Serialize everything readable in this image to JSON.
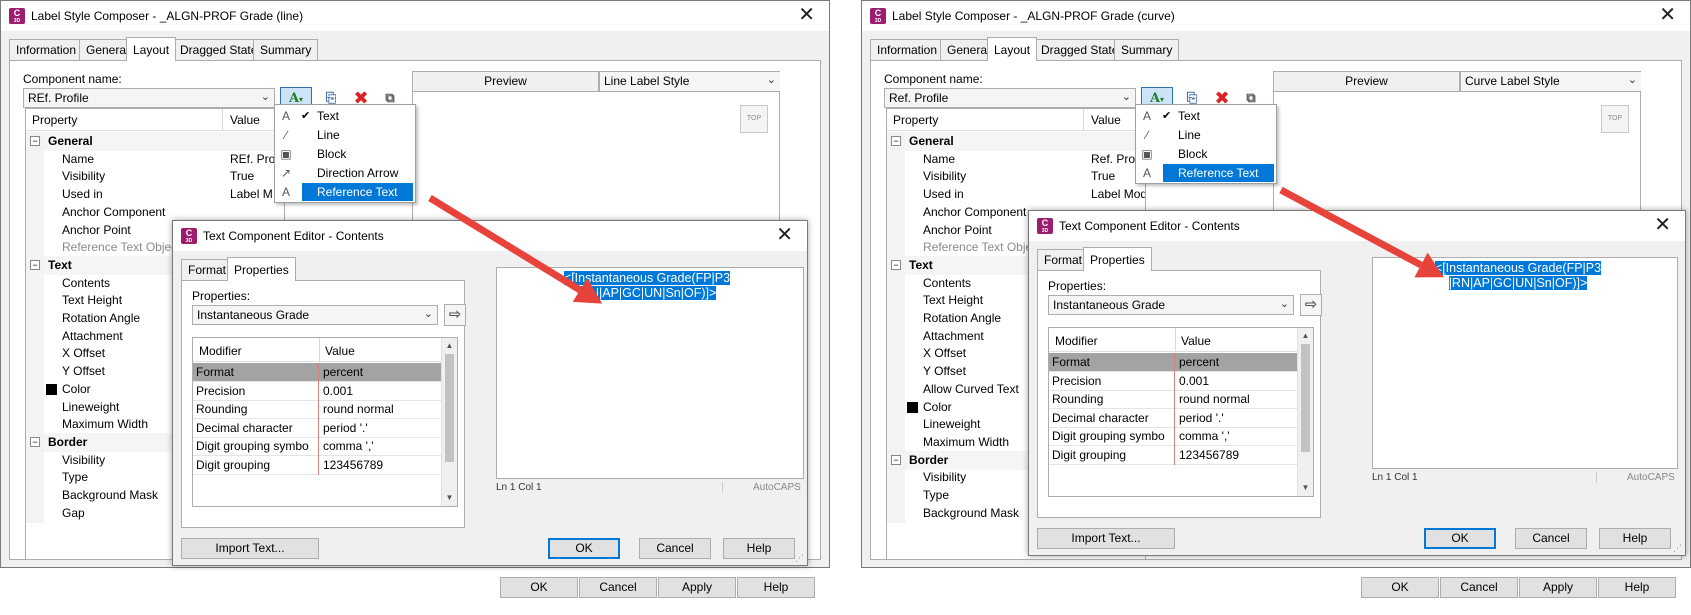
{
  "left": {
    "window_title": "Label Style Composer - _ALGN-PROF Grade (line)",
    "tabs": [
      "Information",
      "General",
      "Layout",
      "Dragged State",
      "Summary"
    ],
    "active_tab": "Layout",
    "component_name_label": "Component name:",
    "component_name_value": "REf. Profile",
    "preview_header": "Preview",
    "preview_style": "Line Label Style",
    "top_button": "TOP",
    "grid_headers": {
      "property": "Property",
      "value": "Value"
    },
    "properties": [
      {
        "name": "General",
        "category": true
      },
      {
        "name": "Name",
        "value": "REf. Pro"
      },
      {
        "name": "Visibility",
        "value": "True"
      },
      {
        "name": "Used in",
        "value": "Label M"
      },
      {
        "name": "Anchor Component",
        "value": ""
      },
      {
        "name": "Anchor Point",
        "value": ""
      },
      {
        "name": "Reference Text Object",
        "value": "",
        "dim": true
      },
      {
        "name": "Text",
        "category": true
      },
      {
        "name": "Contents",
        "value": ""
      },
      {
        "name": "Text Height",
        "value": ""
      },
      {
        "name": "Rotation Angle",
        "value": ""
      },
      {
        "name": "Attachment",
        "value": ""
      },
      {
        "name": "X Offset",
        "value": ""
      },
      {
        "name": "Y Offset",
        "value": ""
      },
      {
        "name": "Color",
        "value": "",
        "swatch": true
      },
      {
        "name": "Lineweight",
        "value": ""
      },
      {
        "name": "Maximum Width",
        "value": ""
      },
      {
        "name": "Border",
        "category": true
      },
      {
        "name": "Visibility",
        "value": ""
      },
      {
        "name": "Type",
        "value": ""
      },
      {
        "name": "Background Mask",
        "value": ""
      },
      {
        "name": "Gap",
        "value": ""
      }
    ],
    "menu": [
      {
        "label": "Text",
        "checked": true
      },
      {
        "label": "Line"
      },
      {
        "label": "Block"
      },
      {
        "label": "Direction Arrow"
      },
      {
        "label": "Reference Text",
        "highlighted": true
      }
    ],
    "editor": {
      "title": "Text Component Editor - Contents",
      "tabs": [
        "Format",
        "Properties"
      ],
      "active_tab": "Properties",
      "properties_label": "Properties:",
      "property_selected": "Instantaneous Grade",
      "grid_headers": {
        "modifier": "Modifier",
        "value": "Value"
      },
      "modifiers": [
        {
          "name": "Format",
          "value": "percent",
          "selected": true
        },
        {
          "name": "Precision",
          "value": "0.001"
        },
        {
          "name": "Rounding",
          "value": "round normal"
        },
        {
          "name": "Decimal character",
          "value": "period '.'"
        },
        {
          "name": "Digit grouping symbo",
          "value": "comma ','"
        },
        {
          "name": "Digit grouping",
          "value": "123456789"
        }
      ],
      "content_line1": "<[Instantaneous Grade(FP|P3",
      "content_line2": "|RN|AP|GC|UN|Sn|OF)]>",
      "status_pos": "Ln 1 Col 1",
      "status_caps": "AutoCAPS",
      "import_button": "Import Text...",
      "ok": "OK",
      "cancel": "Cancel",
      "help": "Help"
    },
    "buttons": {
      "ok": "OK",
      "cancel": "Cancel",
      "apply": "Apply",
      "help": "Help"
    }
  },
  "right": {
    "window_title": "Label Style Composer - _ALGN-PROF Grade (curve)",
    "tabs": [
      "Information",
      "General",
      "Layout",
      "Dragged State",
      "Summary"
    ],
    "active_tab": "Layout",
    "component_name_label": "Component name:",
    "component_name_value": "Ref. Profile",
    "preview_header": "Preview",
    "preview_style": "Curve Label Style",
    "top_button": "TOP",
    "grid_headers": {
      "property": "Property",
      "value": "Value"
    },
    "properties": [
      {
        "name": "General",
        "category": true
      },
      {
        "name": "Name",
        "value": "Ref. Pro"
      },
      {
        "name": "Visibility",
        "value": "True"
      },
      {
        "name": "Used in",
        "value": "Label Mode"
      },
      {
        "name": "Anchor Component",
        "value": ""
      },
      {
        "name": "Anchor Point",
        "value": ""
      },
      {
        "name": "Reference Text Object",
        "value": "",
        "dim": true
      },
      {
        "name": "Text",
        "category": true
      },
      {
        "name": "Contents",
        "value": ""
      },
      {
        "name": "Text Height",
        "value": ""
      },
      {
        "name": "Rotation Angle",
        "value": ""
      },
      {
        "name": "Attachment",
        "value": ""
      },
      {
        "name": "X Offset",
        "value": ""
      },
      {
        "name": "Y Offset",
        "value": ""
      },
      {
        "name": "Allow Curved Text",
        "value": ""
      },
      {
        "name": "Color",
        "value": "",
        "swatch": true
      },
      {
        "name": "Lineweight",
        "value": ""
      },
      {
        "name": "Maximum Width",
        "value": ""
      },
      {
        "name": "Border",
        "category": true
      },
      {
        "name": "Visibility",
        "value": ""
      },
      {
        "name": "Type",
        "value": ""
      },
      {
        "name": "Background Mask",
        "value": ""
      }
    ],
    "menu": [
      {
        "label": "Text",
        "checked": true
      },
      {
        "label": "Line"
      },
      {
        "label": "Block"
      },
      {
        "label": "Reference Text",
        "highlighted": true
      }
    ],
    "editor": {
      "title": "Text Component Editor - Contents",
      "tabs": [
        "Format",
        "Properties"
      ],
      "active_tab": "Properties",
      "properties_label": "Properties:",
      "property_selected": "Instantaneous Grade",
      "grid_headers": {
        "modifier": "Modifier",
        "value": "Value"
      },
      "modifiers": [
        {
          "name": "Format",
          "value": "percent",
          "selected": true
        },
        {
          "name": "Precision",
          "value": "0.001"
        },
        {
          "name": "Rounding",
          "value": "round normal"
        },
        {
          "name": "Decimal character",
          "value": "period '.'"
        },
        {
          "name": "Digit grouping symbo",
          "value": "comma ','"
        },
        {
          "name": "Digit grouping",
          "value": "123456789"
        }
      ],
      "content_line1": "<[Instantaneous Grade(FP|P3",
      "content_line2": "|RN|AP|GC|UN|Sn|OF)]>",
      "status_pos": "Ln 1 Col 1",
      "status_caps": "AutoCAPS",
      "import_button": "Import Text...",
      "ok": "OK",
      "cancel": "Cancel",
      "help": "Help"
    },
    "buttons": {
      "ok": "OK",
      "cancel": "Cancel",
      "apply": "Apply",
      "help": "Help"
    }
  },
  "colors": {
    "accent": "#0078d7",
    "arrow": "#e8433a",
    "app_icon": "#9c1c6e"
  },
  "icons": {
    "app": "civil3d-app-icon",
    "add_component": "add-text-component-icon",
    "copy_component": "copy-component-icon",
    "delete_component": "delete-red-x-icon",
    "draw_order": "draw-order-icon",
    "insert_property": "insert-arrow-icon"
  }
}
